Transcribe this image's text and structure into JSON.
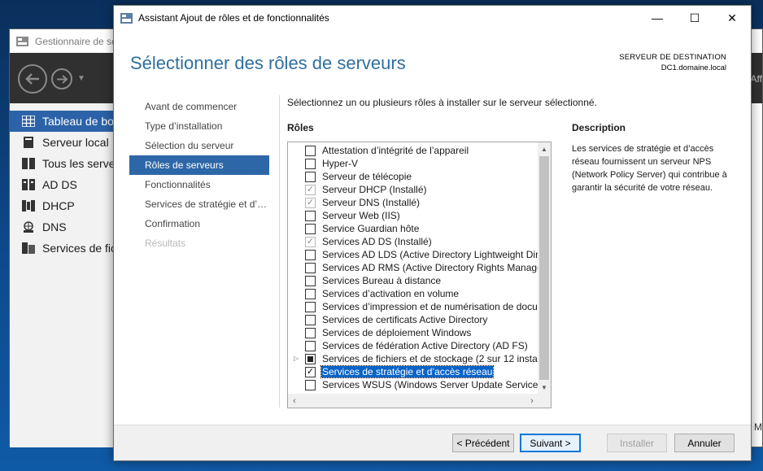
{
  "server_manager": {
    "title": "Gestionnaire de ser",
    "right_text": "Aff",
    "side_m": "M",
    "nav": [
      {
        "label": "Tableau de bo",
        "icon": "dashboard-icon"
      },
      {
        "label": "Serveur local",
        "icon": "server-icon"
      },
      {
        "label": "Tous les server",
        "icon": "servers-icon"
      },
      {
        "label": "AD DS",
        "icon": "ad-ds-icon"
      },
      {
        "label": "DHCP",
        "icon": "dhcp-icon"
      },
      {
        "label": "DNS",
        "icon": "dns-icon"
      },
      {
        "label": "Services de fic",
        "icon": "file-services-icon"
      }
    ]
  },
  "wizard": {
    "title": "Assistant Ajout de rôles et de fonctionnalités",
    "heading": "Sélectionner des rôles de serveurs",
    "destination_label": "SERVEUR DE DESTINATION",
    "destination_server": "DC1.domaine.local",
    "steps": [
      {
        "label": "Avant de commencer",
        "state": "normal"
      },
      {
        "label": "Type d’installation",
        "state": "normal"
      },
      {
        "label": "Sélection du serveur",
        "state": "normal"
      },
      {
        "label": "Rôles de serveurs",
        "state": "current"
      },
      {
        "label": "Fonctionnalités",
        "state": "normal"
      },
      {
        "label": "Services de stratégie et d’…",
        "state": "normal"
      },
      {
        "label": "Confirmation",
        "state": "normal"
      },
      {
        "label": "Résultats",
        "state": "disabled"
      }
    ],
    "instruction": "Sélectionnez un ou plusieurs rôles à installer sur le serveur sélectionné.",
    "roles_header": "Rôles",
    "description_header": "Description",
    "description_text": "Les services de stratégie et d’accès réseau fournissent un serveur NPS (Network Policy Server) qui contribue à garantir la sécurité de votre réseau.",
    "roles": [
      {
        "label": "Attestation d’intégrité de l’appareil",
        "state": "unchecked"
      },
      {
        "label": "Hyper-V",
        "state": "unchecked"
      },
      {
        "label": "Serveur de télécopie",
        "state": "unchecked"
      },
      {
        "label": "Serveur DHCP (Installé)",
        "state": "installed"
      },
      {
        "label": "Serveur DNS (Installé)",
        "state": "installed"
      },
      {
        "label": "Serveur Web (IIS)",
        "state": "unchecked"
      },
      {
        "label": "Service Guardian hôte",
        "state": "unchecked"
      },
      {
        "label": "Services AD DS (Installé)",
        "state": "installed"
      },
      {
        "label": "Services AD LDS (Active Directory Lightweight Dire",
        "state": "unchecked"
      },
      {
        "label": "Services AD RMS (Active Directory Rights Manager",
        "state": "unchecked"
      },
      {
        "label": "Services Bureau à distance",
        "state": "unchecked"
      },
      {
        "label": "Services d’activation en volume",
        "state": "unchecked"
      },
      {
        "label": "Services d’impression et de numérisation de docur",
        "state": "unchecked"
      },
      {
        "label": "Services de certificats Active Directory",
        "state": "unchecked"
      },
      {
        "label": "Services de déploiement Windows",
        "state": "unchecked"
      },
      {
        "label": "Services de fédération Active Directory (AD FS)",
        "state": "unchecked"
      },
      {
        "label": "Services de fichiers et de stockage (2 sur 12 installé",
        "state": "partial",
        "expandable": true
      },
      {
        "label": "Services de stratégie et d’accès réseau",
        "state": "checked",
        "selected": true
      },
      {
        "label": "Services WSUS (Windows Server Update Services)",
        "state": "unchecked"
      }
    ],
    "buttons": {
      "previous": "< Précédent",
      "next": "Suivant >",
      "install": "Installer",
      "cancel": "Annuler"
    },
    "window_controls": {
      "minimize": "—",
      "maximize": "☐",
      "close": "✕"
    }
  }
}
